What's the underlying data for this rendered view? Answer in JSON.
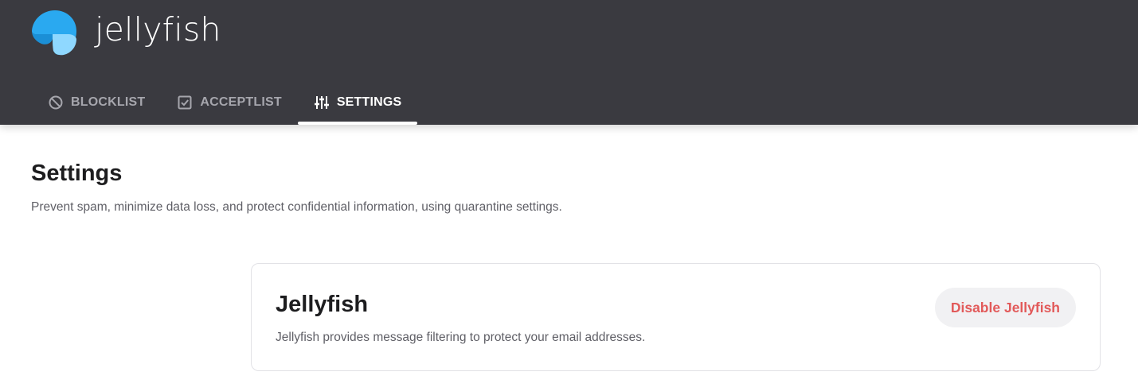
{
  "app": {
    "name": "jellyfish",
    "brand_colors": {
      "header_bg": "#3a3a40",
      "logo_primary": "#2aa9f0",
      "logo_secondary": "#8fd8ff",
      "danger": "#e25a5a"
    }
  },
  "nav": {
    "tabs": [
      {
        "label": "BLOCKLIST",
        "icon": "block-icon",
        "active": false
      },
      {
        "label": "ACCEPTLIST",
        "icon": "checkbox-icon",
        "active": false
      },
      {
        "label": "SETTINGS",
        "icon": "sliders-icon",
        "active": true
      }
    ]
  },
  "page": {
    "title": "Settings",
    "description": "Prevent spam, minimize data loss, and protect confidential information, using quarantine settings."
  },
  "card": {
    "title": "Jellyfish",
    "description": "Jellyfish provides message filtering to protect your email addresses.",
    "button_label": "Disable Jellyfish"
  }
}
